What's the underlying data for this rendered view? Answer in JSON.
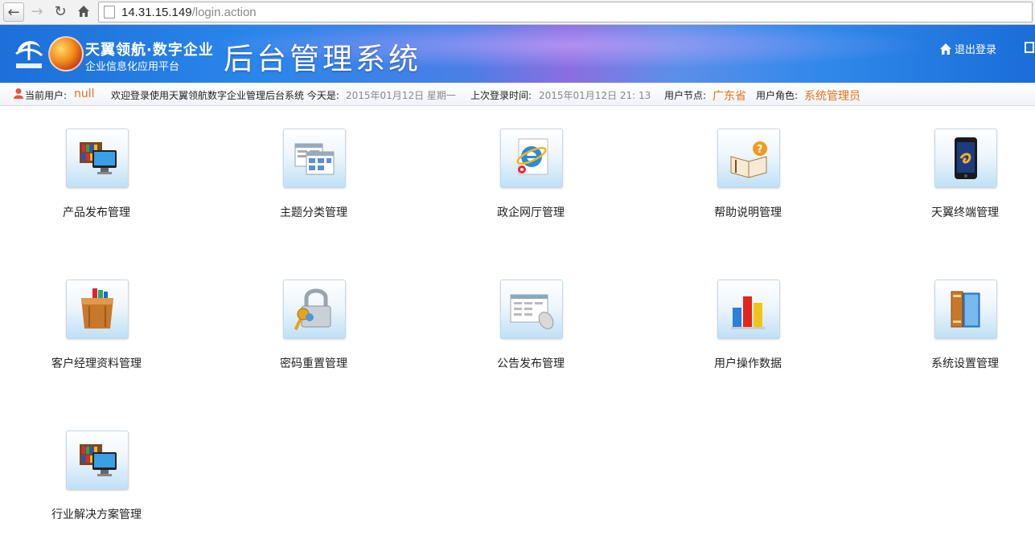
{
  "browser": {
    "url_host": "14.31.15.149",
    "url_path": "/login.action"
  },
  "header": {
    "brand_title": "天翼领航·数字企业",
    "brand_subtitle": "企业信息化应用平台",
    "system_title": "后台管理系统",
    "logout_label": "退出登录"
  },
  "infobar": {
    "current_user_label": "当前用户:",
    "current_user_value": "null",
    "welcome_text": "欢迎登录使用天翼领航数字企业管理后台系统 今天是:",
    "today_value": "2015年01月12日 星期一",
    "last_login_label": "上次登录时间:",
    "last_login_value": "2015年01月12日 21: 13",
    "node_label": "用户节点:",
    "node_value": "广东省",
    "role_label": "用户角色:",
    "role_value": "系统管理员"
  },
  "tiles": [
    {
      "label": "产品发布管理",
      "icon": "computer-books-icon"
    },
    {
      "label": "主题分类管理",
      "icon": "windows-icon"
    },
    {
      "label": "政企网厅管理",
      "icon": "ie-browser-icon"
    },
    {
      "label": "帮助说明管理",
      "icon": "help-book-icon"
    },
    {
      "label": "天翼终端管理",
      "icon": "phone-icon"
    },
    {
      "label": "客户经理资料管理",
      "icon": "file-box-icon"
    },
    {
      "label": "密码重置管理",
      "icon": "lock-keys-icon"
    },
    {
      "label": "公告发布管理",
      "icon": "announcement-icon"
    },
    {
      "label": "用户操作数据",
      "icon": "bar-chart-icon"
    },
    {
      "label": "系统设置管理",
      "icon": "books-icon"
    },
    {
      "label": "行业解决方案管理",
      "icon": "computer-books-icon"
    }
  ],
  "colors": {
    "accent_orange": "#e0751a",
    "header_blue": "#2a86ea"
  }
}
